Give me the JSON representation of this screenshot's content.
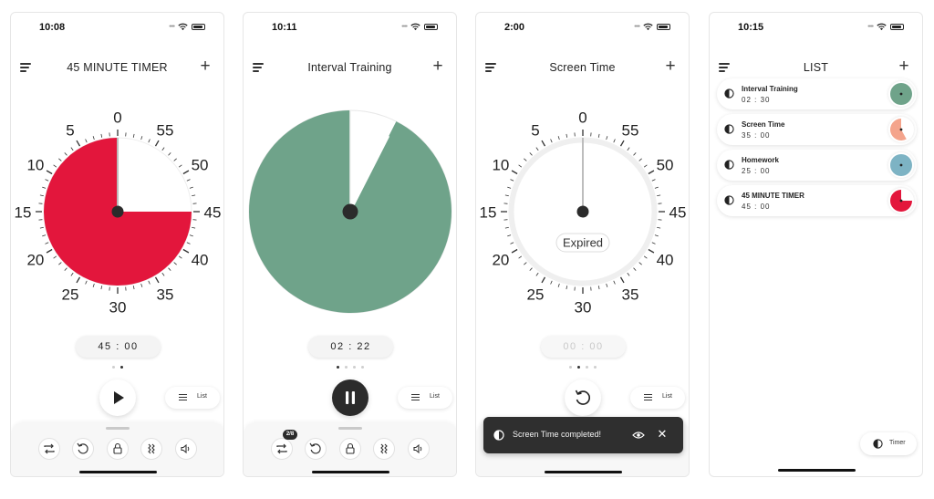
{
  "screens": [
    {
      "status_time": "10:08",
      "title": "45 MINUTE TIMER",
      "dial": {
        "fill_color": "#e3163c",
        "remaining_minutes": 45,
        "expired": false
      },
      "time_display": "45 : 00",
      "page_dots": {
        "count": 2,
        "active": 1
      },
      "main_control": "play",
      "list_label": "List",
      "toolbar": {
        "badge": ""
      }
    },
    {
      "status_time": "10:11",
      "title": "Interval Training",
      "dial": {
        "fill_color": "#6fa38a",
        "remaining_minutes": 55.5,
        "expired": false,
        "full_face": true
      },
      "time_display": "02 : 22",
      "page_dots": {
        "count": 4,
        "active": 0
      },
      "main_control": "pause",
      "list_label": "List",
      "toolbar": {
        "badge": "2/8"
      }
    },
    {
      "status_time": "2:00",
      "title": "Screen Time",
      "dial": {
        "fill_color": "#f4a48c",
        "remaining_minutes": 0,
        "expired": true,
        "expired_label": "Expired"
      },
      "time_display": "00 : 00",
      "page_dots": {
        "count": 4,
        "active": 1
      },
      "main_control": "reset",
      "list_label": "List",
      "toast": {
        "message": "Screen Time completed!"
      }
    },
    {
      "status_time": "10:15",
      "title": "LIST",
      "items": [
        {
          "name": "Interval Training",
          "time": "02 : 30",
          "color": "#6fa38a",
          "fill_fraction": 1.0
        },
        {
          "name": "Screen Time",
          "time": "35 : 00",
          "color": "#f4a48c",
          "fill_fraction": 0.58
        },
        {
          "name": "Homework",
          "time": "25 : 00",
          "color": "#7db3c4",
          "fill_fraction": 1.0
        },
        {
          "name": "45 MINUTE TIMER",
          "time": "45 : 00",
          "color": "#e3163c",
          "fill_fraction": 0.75
        }
      ],
      "timer_label": "Timer"
    }
  ],
  "dial_labels": [
    "0",
    "5",
    "10",
    "15",
    "20",
    "25",
    "30",
    "35",
    "40",
    "45",
    "50",
    "55"
  ]
}
